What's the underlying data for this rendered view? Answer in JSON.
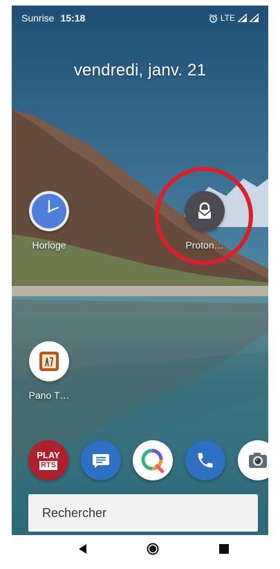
{
  "status_bar": {
    "carrier": "Sunrise",
    "time": "15:18",
    "network": "LTE",
    "icons": [
      "alarm-icon",
      "signal-icon",
      "signal-icon"
    ]
  },
  "date": "vendredi, janv. 21",
  "home_apps": [
    {
      "label": "Horloge",
      "icon": "clock-icon"
    },
    {
      "label": "Proton…",
      "icon": "protonmail-icon"
    },
    {
      "label": "Pano T…",
      "icon": "pano-icon"
    }
  ],
  "dock": [
    {
      "icon": "play-rts-icon",
      "text_line1": "PLAY",
      "text_line2": "RTS"
    },
    {
      "icon": "messages-icon"
    },
    {
      "icon": "qwant-icon"
    },
    {
      "icon": "phone-icon"
    },
    {
      "icon": "camera-icon"
    }
  ],
  "search": {
    "placeholder": "Rechercher"
  },
  "nav": [
    "back-icon",
    "home-icon",
    "recents-icon"
  ],
  "colors": {
    "highlight": "#d9202a",
    "clock_face": "#4f7fd9",
    "proton_bg": "#4b4a52",
    "play_rts": "#b0202c",
    "dock_blue": "#2f6fc2"
  }
}
